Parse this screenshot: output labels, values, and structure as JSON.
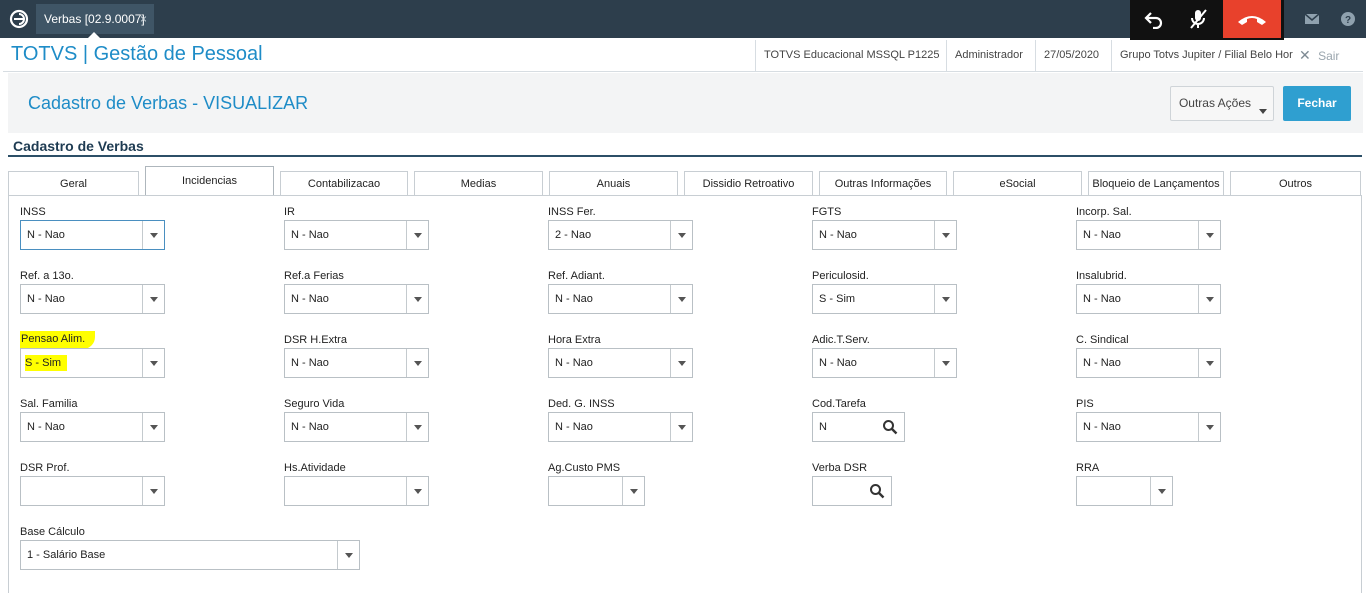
{
  "window_tab": {
    "label": "Verbas [02.9.0007]",
    "close": "×"
  },
  "header": {
    "app_title": "TOTVS | Gestão de Pessoal",
    "environment": "TOTVS Educacional MSSQL P1225",
    "user": "Administrador",
    "date": "27/05/2020",
    "company": "Grupo Totvs Jupiter / Filial Belo Hor",
    "exit_label": "Sair"
  },
  "page": {
    "title": "Cadastro de Verbas - VISUALIZAR",
    "other_actions_label": "Outras Ações",
    "close_label": "Fechar",
    "section_title": "Cadastro de Verbas"
  },
  "tabs": [
    "Geral",
    "Incidencias",
    "Contabilizacao",
    "Medias",
    "Anuais",
    "Dissidio Retroativo",
    "Outras Informações",
    "eSocial",
    "Bloqueio de Lançamentos",
    "Outros"
  ],
  "active_tab": "Incidencias",
  "fields": {
    "inss": {
      "label": "INSS",
      "value": "N - Nao"
    },
    "ir": {
      "label": "IR",
      "value": "N - Nao"
    },
    "inss_fer": {
      "label": "INSS Fer.",
      "value": "2 - Nao"
    },
    "fgts": {
      "label": "FGTS",
      "value": "N - Nao"
    },
    "incorp_sal": {
      "label": "Incorp. Sal.",
      "value": "N - Nao"
    },
    "ref_13": {
      "label": "Ref. a 13o.",
      "value": "N - Nao"
    },
    "ref_ferias": {
      "label": "Ref.a Ferias",
      "value": "N - Nao"
    },
    "ref_adiant": {
      "label": "Ref. Adiant.",
      "value": "N - Nao"
    },
    "periculosid": {
      "label": "Periculosid.",
      "value": "S - Sim"
    },
    "insalubrid": {
      "label": "Insalubrid.",
      "value": "N - Nao"
    },
    "pensao_alim": {
      "label": "Pensao Alim.",
      "value": "S - Sim"
    },
    "dsr_hextra": {
      "label": "DSR H.Extra",
      "value": "N - Nao"
    },
    "hora_extra": {
      "label": "Hora Extra",
      "value": "N - Nao"
    },
    "adic_tserv": {
      "label": "Adic.T.Serv.",
      "value": "N - Nao"
    },
    "c_sindical": {
      "label": "C. Sindical",
      "value": "N - Nao"
    },
    "sal_familia": {
      "label": "Sal. Familia",
      "value": "N - Nao"
    },
    "seguro_vida": {
      "label": "Seguro Vida",
      "value": "N - Nao"
    },
    "ded_g_inss": {
      "label": "Ded. G. INSS",
      "value": "N - Nao"
    },
    "cod_tarefa": {
      "label": "Cod.Tarefa",
      "value": "N"
    },
    "pis": {
      "label": "PIS",
      "value": "N - Nao"
    },
    "dsr_prof": {
      "label": "DSR Prof.",
      "value": ""
    },
    "hs_atividade": {
      "label": "Hs.Atividade",
      "value": ""
    },
    "ag_custo_pms": {
      "label": "Ag.Custo PMS",
      "value": ""
    },
    "verba_dsr": {
      "label": "Verba DSR",
      "value": ""
    },
    "rra": {
      "label": "RRA",
      "value": ""
    },
    "base_calculo": {
      "label": "Base Cálculo",
      "value": "1 - Salário Base"
    }
  },
  "highlight_color": "#ffff00",
  "accent_color": "#1e8cc7",
  "end_call_color": "#e8412c"
}
